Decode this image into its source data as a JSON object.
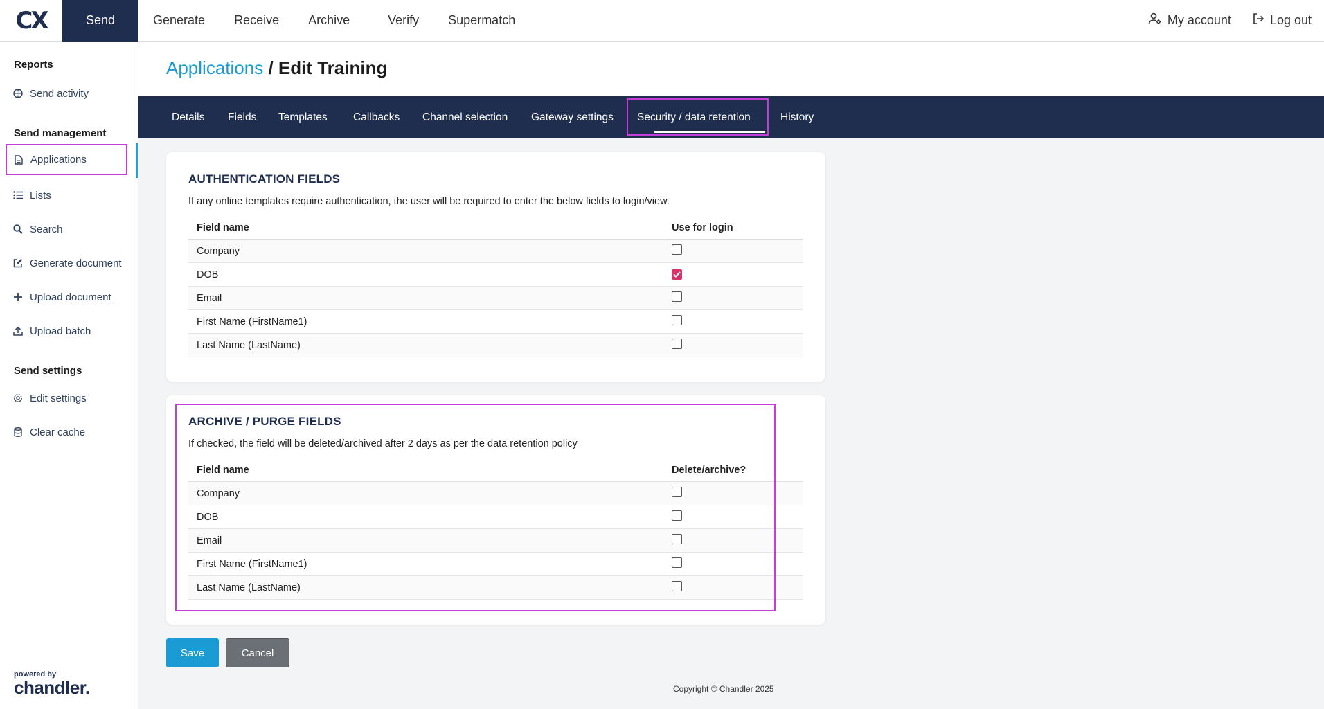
{
  "topnav": {
    "logo": "CX",
    "items": [
      "Send",
      "Generate",
      "Receive",
      "Archive",
      "Verify",
      "Supermatch"
    ],
    "active": "Send",
    "my_account": "My account",
    "log_out": "Log out"
  },
  "sidebar": {
    "sections": {
      "reports": "Reports",
      "send_management": "Send management",
      "send_settings": "Send settings"
    },
    "items": {
      "send_activity": "Send activity",
      "applications": "Applications",
      "lists": "Lists",
      "search": "Search",
      "generate_document": "Generate document",
      "upload_document": "Upload document",
      "upload_batch": "Upload batch",
      "edit_settings": "Edit settings",
      "clear_cache": "Clear cache"
    },
    "powered_by": "powered by",
    "brand": "chandler."
  },
  "header": {
    "breadcrumb": "Applications",
    "separator": "/",
    "title": "Edit Training"
  },
  "tabs": [
    "Details",
    "Fields",
    "Templates",
    "Callbacks",
    "Channel selection",
    "Gateway settings",
    "Security / data retention",
    "History"
  ],
  "active_tab": "Security / data retention",
  "auth": {
    "heading": "AUTHENTICATION FIELDS",
    "description": "If any online templates require authentication, the user will be required to enter the below fields to login/view.",
    "col_field": "Field name",
    "col_check": "Use for login",
    "rows": [
      {
        "name": "Company",
        "checked": false
      },
      {
        "name": "DOB",
        "checked": true
      },
      {
        "name": "Email",
        "checked": false
      },
      {
        "name": "First Name (FirstName1)",
        "checked": false
      },
      {
        "name": "Last Name (LastName)",
        "checked": false
      }
    ]
  },
  "archive": {
    "heading": "ARCHIVE / PURGE FIELDS",
    "description": "If checked, the field will be deleted/archived after 2 days as per the data retention policy",
    "col_field": "Field name",
    "col_check": "Delete/archive?",
    "rows": [
      {
        "name": "Company",
        "checked": false
      },
      {
        "name": "DOB",
        "checked": false
      },
      {
        "name": "Email",
        "checked": false
      },
      {
        "name": "First Name (FirstName1)",
        "checked": false
      },
      {
        "name": "Last Name (LastName)",
        "checked": false
      }
    ]
  },
  "buttons": {
    "save": "Save",
    "cancel": "Cancel"
  },
  "footer": "Copyright © Chandler 2025",
  "colors": {
    "navy": "#1f2d4e",
    "accent": "#1a9bd4",
    "highlight": "#c43dd8",
    "checked": "#d6336c"
  }
}
